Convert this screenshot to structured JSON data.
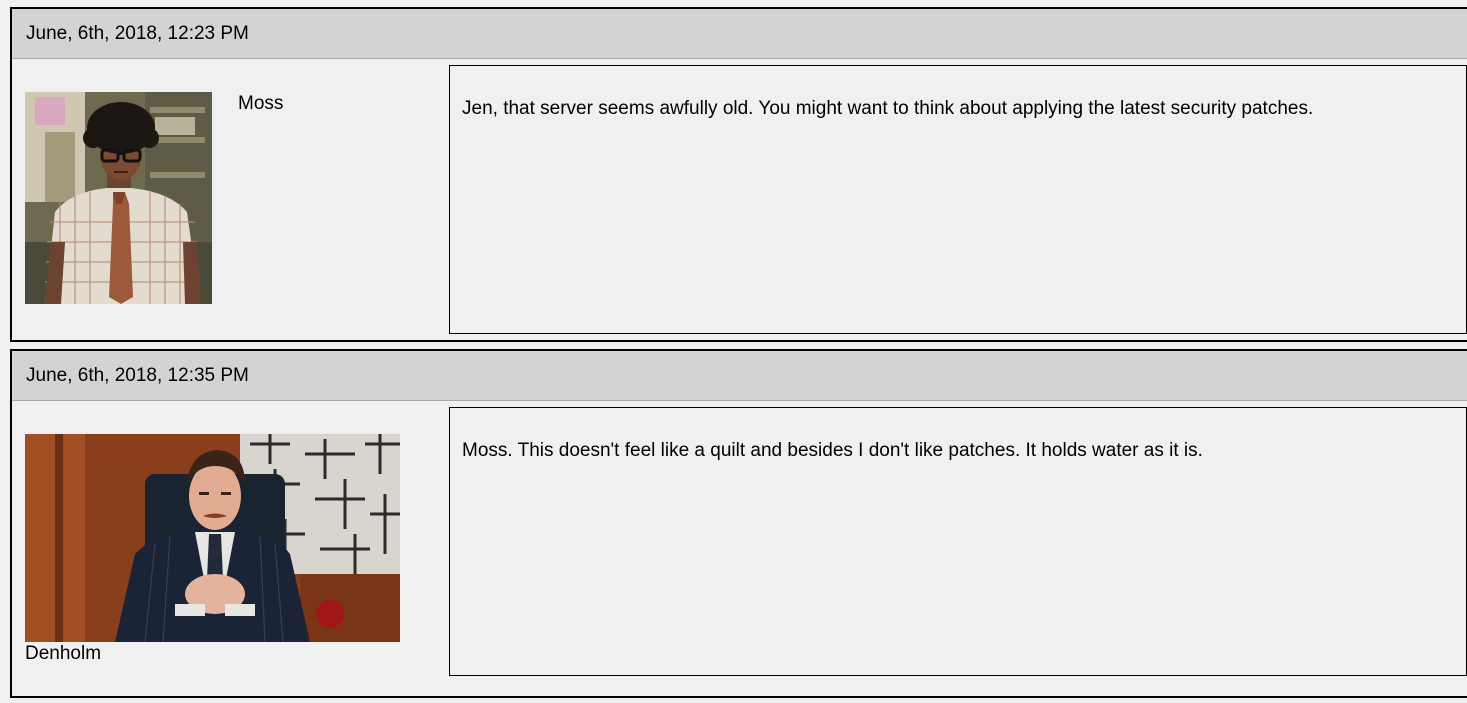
{
  "posts": [
    {
      "timestamp": "June, 6th, 2018, 12:23 PM",
      "author": "Moss",
      "avatar_icon": "man-with-afro-glasses-and-tie-photo",
      "message": "Jen, that server seems awfully old. You might want to think about applying the latest security patches."
    },
    {
      "timestamp": "June, 6th, 2018, 12:35 PM",
      "author": "Denholm",
      "avatar_icon": "man-in-suit-at-desk-photo",
      "message": "Moss. This doesn't feel like a quilt and besides I don't like patches. It holds water as it is."
    }
  ],
  "colors": {
    "page_background": "#f0f0f0",
    "header_background": "#d3d3d3",
    "border": "#000000"
  }
}
